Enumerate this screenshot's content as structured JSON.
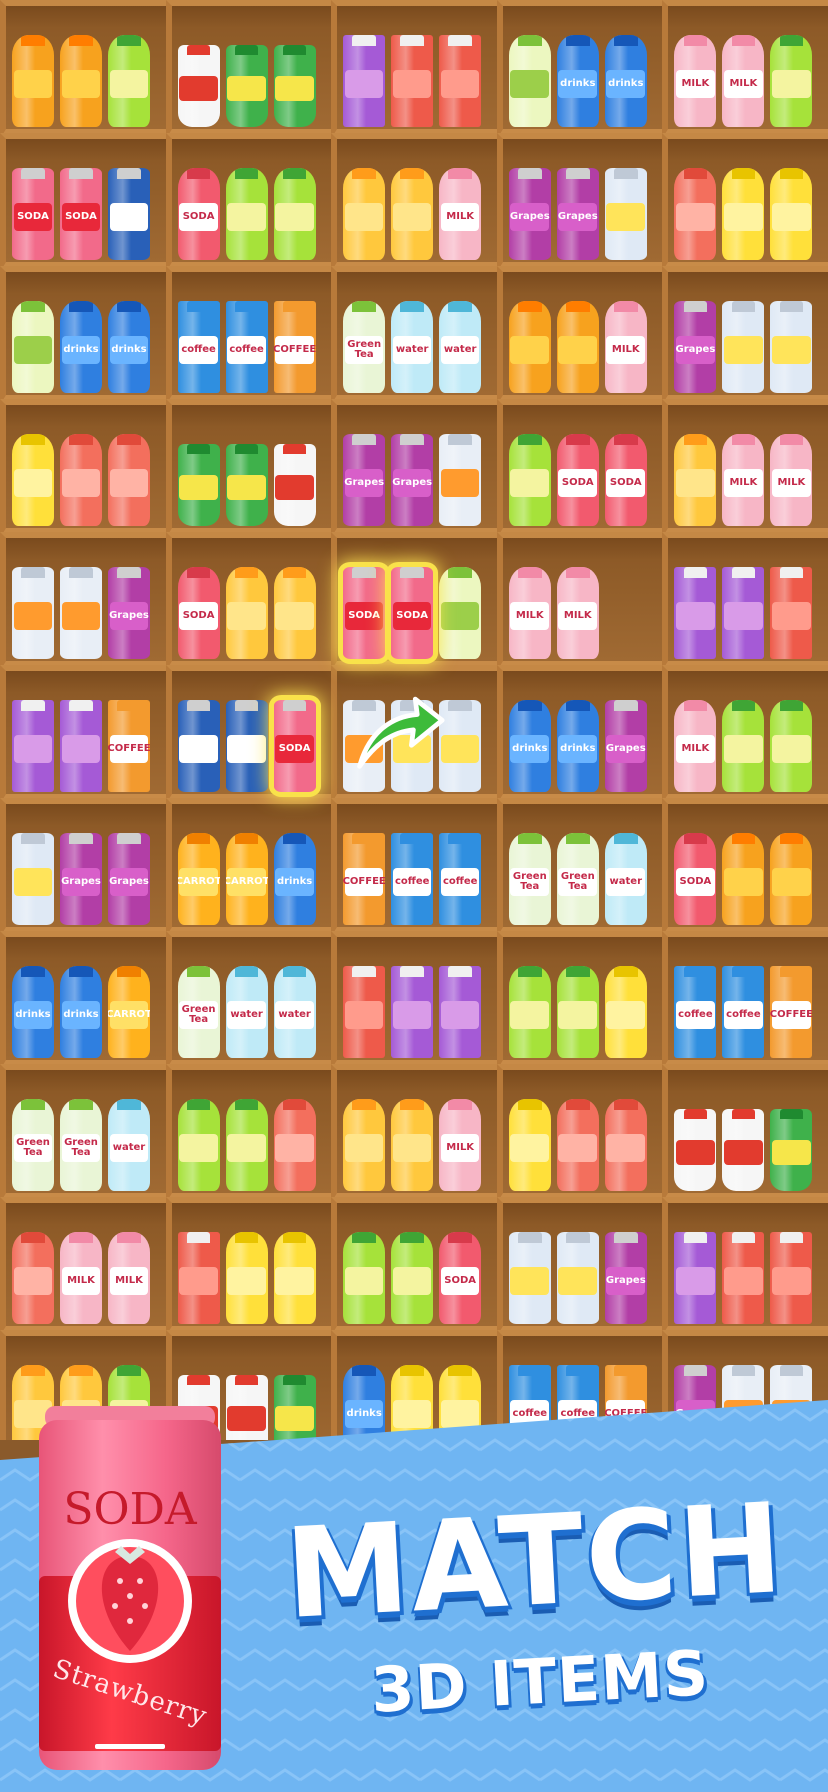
{
  "banner": {
    "title": "MATCH",
    "subtitle": "3D ITEMS",
    "colors": {
      "banner_blue": "#6fb5f2",
      "banner_light": "#9fd0fa",
      "text_shadow": "#1f6fd0"
    }
  },
  "featured_item": {
    "brand": "SODA",
    "flavor": "Strawberry",
    "icon": "strawberry-soda-can"
  },
  "item_types": {
    "orange_bottle": {
      "shape": "bottle",
      "body": "#f7a21e",
      "cap": "#ff7d00",
      "label": "#ffd24a",
      "text": ""
    },
    "lime_bottle": {
      "shape": "bottle",
      "body": "#a6e23a",
      "cap": "#3fa535",
      "label": "#f4f4a0",
      "text": ""
    },
    "yellow_bottle": {
      "shape": "bottle",
      "body": "#ffe03a",
      "cap": "#e8c400",
      "label": "#fff3a0",
      "text": ""
    },
    "watermelon": {
      "shape": "bottle",
      "body": "#f36f5d",
      "cap": "#e14a3a",
      "label": "#ffb3a5",
      "text": ""
    },
    "milk": {
      "shape": "bottle",
      "body": "#f7b6c6",
      "cap": "#f28aa7",
      "label": "#ffffff",
      "text": "MILK"
    },
    "soda_bottle": {
      "shape": "bottle",
      "body": "#f25a6e",
      "cap": "#d83a4b",
      "label": "#ffffff",
      "text": "SODA"
    },
    "blue_drink": {
      "shape": "bottle",
      "body": "#2f7fe0",
      "cap": "#1557b8",
      "label": "#6ab4ff",
      "text": "drinks"
    },
    "water": {
      "shape": "bottle",
      "body": "#bfeaf7",
      "cap": "#4fb7d8",
      "label": "#ffffff",
      "text": "water"
    },
    "green_tea": {
      "shape": "bottle",
      "body": "#e9f5d6",
      "cap": "#7cc23a",
      "label": "#ffffff",
      "text": "Green Tea"
    },
    "mango": {
      "shape": "bottle",
      "body": "#ffc83d",
      "cap": "#ff9c1a",
      "label": "#ffe58a",
      "text": ""
    },
    "carrot": {
      "shape": "bottle",
      "body": "#ffb21d",
      "cap": "#f08000",
      "label": "#ffe066",
      "text": "CARROT"
    },
    "lemon_green": {
      "shape": "bottle",
      "body": "#ecf7c0",
      "cap": "#7cc23a",
      "label": "#9ccf4a",
      "text": ""
    },
    "soda_can": {
      "shape": "can",
      "body": "#f26a8a",
      "cap": "#cfcfcf",
      "label": "#e8283a",
      "text": "SODA"
    },
    "grape_can": {
      "shape": "can",
      "body": "#b23ea6",
      "cap": "#cfcfcf",
      "label": "#d85fc9",
      "text": "Grapes"
    },
    "lemon_can": {
      "shape": "can",
      "body": "#dfe9f5",
      "cap": "#bfc9d6",
      "label": "#ffe45a",
      "text": ""
    },
    "blue_can": {
      "shape": "can",
      "body": "#2960b8",
      "cap": "#cfcfcf",
      "label": "#ffffff",
      "text": ""
    },
    "orange_can": {
      "shape": "can",
      "body": "#e8eef6",
      "cap": "#bfc9d6",
      "label": "#ff9b2e",
      "text": ""
    },
    "cup_green": {
      "shape": "cup",
      "body": "#3fb14b",
      "cap": "#1f8a30",
      "label": "#f6e64a",
      "text": ""
    },
    "cup_red": {
      "shape": "cup",
      "body": "#f6f6f6",
      "cap": "#e23b2e",
      "label": "#e23b2e",
      "text": ""
    },
    "grape_juice": {
      "shape": "carton",
      "body": "#a55ad6",
      "cap": "#f0f0f0",
      "label": "#d99be8",
      "text": ""
    },
    "cherry_juice": {
      "shape": "carton",
      "body": "#ee5a4a",
      "cap": "#f0f0f0",
      "label": "#ff9b8c",
      "text": ""
    },
    "coffee_blue": {
      "shape": "carton",
      "body": "#2f8fe0",
      "cap": "#2f8fe0",
      "label": "#ffffff",
      "text": "coffee"
    },
    "coffee_orange": {
      "shape": "carton",
      "body": "#f39a2e",
      "cap": "#f39a2e",
      "label": "#ffffff",
      "text": "COFFEE"
    }
  },
  "shelves": [
    [
      "orange_bottle",
      "orange_bottle",
      "lime_bottle",
      "cup_red",
      "cup_green",
      "cup_green",
      "grape_juice",
      "cherry_juice",
      "cherry_juice",
      "lemon_green",
      "blue_drink",
      "blue_drink",
      "milk",
      "milk",
      "lime_bottle"
    ],
    [
      "soda_can",
      "soda_can",
      "blue_can",
      "soda_bottle",
      "lime_bottle",
      "lime_bottle",
      "mango",
      "mango",
      "milk",
      "grape_can",
      "grape_can",
      "lemon_can",
      "watermelon",
      "yellow_bottle",
      "yellow_bottle"
    ],
    [
      "lemon_green",
      "blue_drink",
      "blue_drink",
      "coffee_blue",
      "coffee_blue",
      "coffee_orange",
      "green_tea",
      "water",
      "water",
      "orange_bottle",
      "orange_bottle",
      "milk",
      "grape_can",
      "lemon_can",
      "lemon_can"
    ],
    [
      "yellow_bottle",
      "watermelon",
      "watermelon",
      "cup_green",
      "cup_green",
      "cup_red",
      "grape_can",
      "grape_can",
      "orange_can",
      "lime_bottle",
      "soda_bottle",
      "soda_bottle",
      "mango",
      "milk",
      "milk"
    ],
    [
      "orange_can",
      "orange_can",
      "grape_can",
      "soda_bottle",
      "mango",
      "mango",
      "soda_can",
      "soda_can",
      "lemon_green",
      "milk",
      "milk",
      "",
      "grape_juice",
      "grape_juice",
      "cherry_juice"
    ],
    [
      "grape_juice",
      "grape_juice",
      "coffee_orange",
      "blue_can",
      "blue_can",
      "soda_can",
      "orange_can",
      "lemon_can",
      "lemon_can",
      "blue_drink",
      "blue_drink",
      "grape_can",
      "milk",
      "lime_bottle",
      "lime_bottle"
    ],
    [
      "lemon_can",
      "grape_can",
      "grape_can",
      "carrot",
      "carrot",
      "blue_drink",
      "coffee_orange",
      "coffee_blue",
      "coffee_blue",
      "green_tea",
      "green_tea",
      "water",
      "soda_bottle",
      "orange_bottle",
      "orange_bottle"
    ],
    [
      "blue_drink",
      "blue_drink",
      "carrot",
      "green_tea",
      "water",
      "water",
      "cherry_juice",
      "grape_juice",
      "grape_juice",
      "lime_bottle",
      "lime_bottle",
      "yellow_bottle",
      "coffee_blue",
      "coffee_blue",
      "coffee_orange"
    ],
    [
      "green_tea",
      "green_tea",
      "water",
      "lime_bottle",
      "lime_bottle",
      "watermelon",
      "mango",
      "mango",
      "milk",
      "yellow_bottle",
      "watermelon",
      "watermelon",
      "cup_red",
      "cup_red",
      "cup_green"
    ],
    [
      "watermelon",
      "milk",
      "milk",
      "cherry_juice",
      "yellow_bottle",
      "yellow_bottle",
      "lime_bottle",
      "lime_bottle",
      "soda_bottle",
      "lemon_can",
      "lemon_can",
      "grape_can",
      "grape_juice",
      "cherry_juice",
      "cherry_juice"
    ],
    [
      "mango",
      "mango",
      "lime_bottle",
      "cup_red",
      "cup_red",
      "cup_green",
      "blue_drink",
      "yellow_bottle",
      "yellow_bottle",
      "coffee_blue",
      "coffee_blue",
      "coffee_orange",
      "grape_can",
      "orange_can",
      "orange_can"
    ]
  ],
  "highlighted": [
    [
      4,
      6
    ],
    [
      4,
      7
    ],
    [
      5,
      5
    ]
  ]
}
